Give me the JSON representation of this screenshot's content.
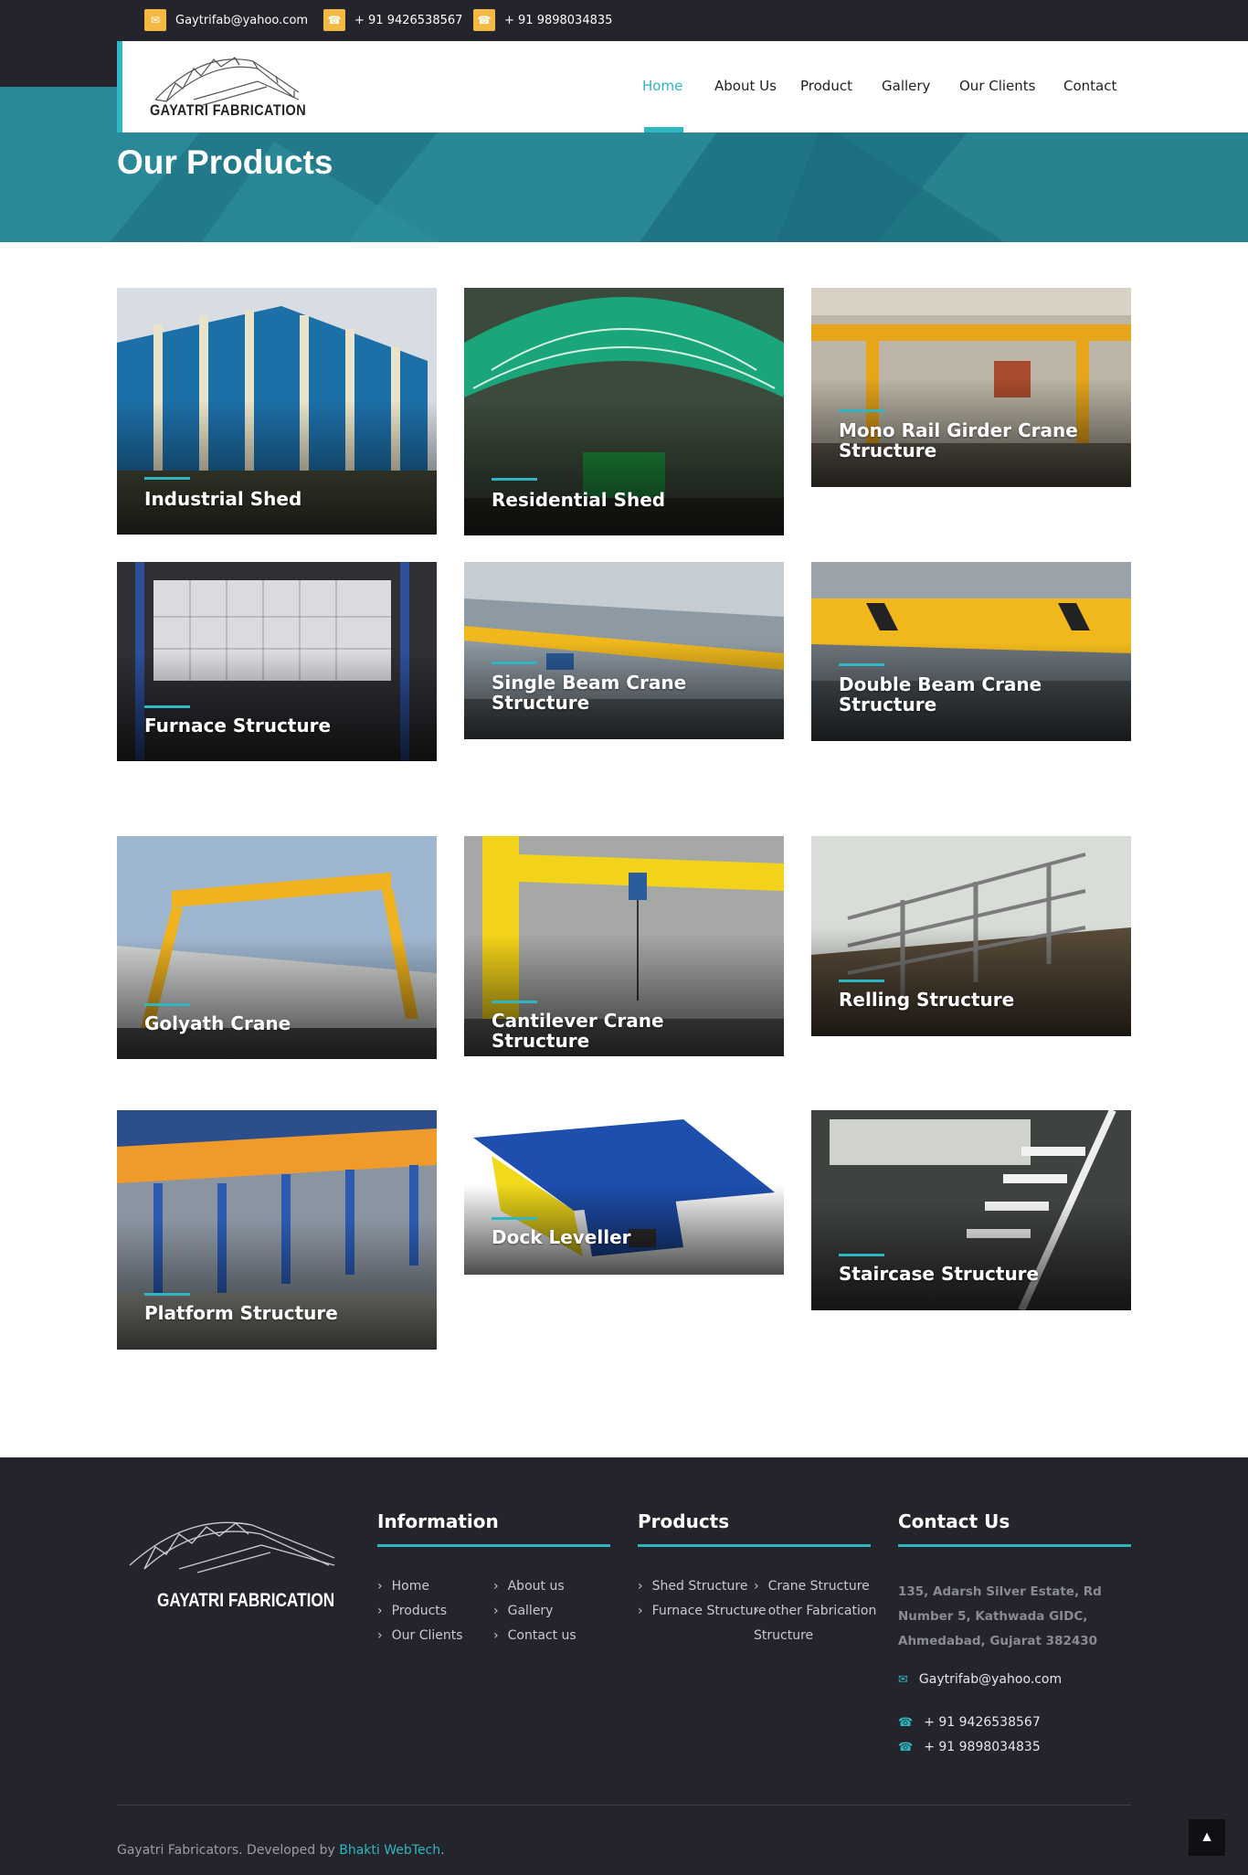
{
  "topbar": {
    "email": "Gaytrifab@yahoo.com",
    "phone1": "+ 91 9426538567",
    "phone2": "+ 91 9898034835"
  },
  "brand": {
    "name": "GAYATRI FABRICATION"
  },
  "nav": {
    "items": [
      "Home",
      "About Us",
      "Product",
      "Gallery",
      "Our Clients",
      "Contact"
    ],
    "active": "Home"
  },
  "hero": {
    "title": "Our Products"
  },
  "products": [
    "Industrial Shed",
    "Residential Shed",
    "Mono Rail Girder Crane Structure",
    "Furnace Structure",
    "Single Beam Crane Structure",
    "Double Beam Crane Structure",
    "Golyath Crane",
    "Cantilever Crane Structure",
    "Relling Structure",
    "Platform Structure",
    "Dock Leveller",
    "Staircase Structure"
  ],
  "footer": {
    "brand": "GAYATRI FABRICATION",
    "information": {
      "title": "Information",
      "links": [
        "Home",
        "About us",
        "Products",
        "Gallery",
        "Our Clients",
        "Contact us"
      ]
    },
    "products": {
      "title": "Products",
      "links": [
        "Shed Structure",
        "Crane Structure",
        "Furnace Structure",
        "other Fabrication",
        "Structure"
      ]
    },
    "contact": {
      "title": "Contact Us",
      "address": "135, Adarsh Silver Estate, Rd Number 5, Kathwada GIDC, Ahmedabad, Gujarat 382430",
      "email": "Gaytrifab@yahoo.com",
      "phone1": "+ 91 9426538567",
      "phone2": "+ 91 9898034835"
    },
    "copyright": "Gayatri Fabricators. Developed by",
    "developer": "Bhakti WebTech",
    "period": "."
  },
  "colors": {
    "accent": "#2fb6c1",
    "dark": "#23242c",
    "hero": "#237d8c",
    "icon_bg": "#f4b942"
  },
  "icons": [
    "envelope-icon",
    "phone-icon",
    "chevron-right-icon",
    "arrow-up-icon"
  ]
}
